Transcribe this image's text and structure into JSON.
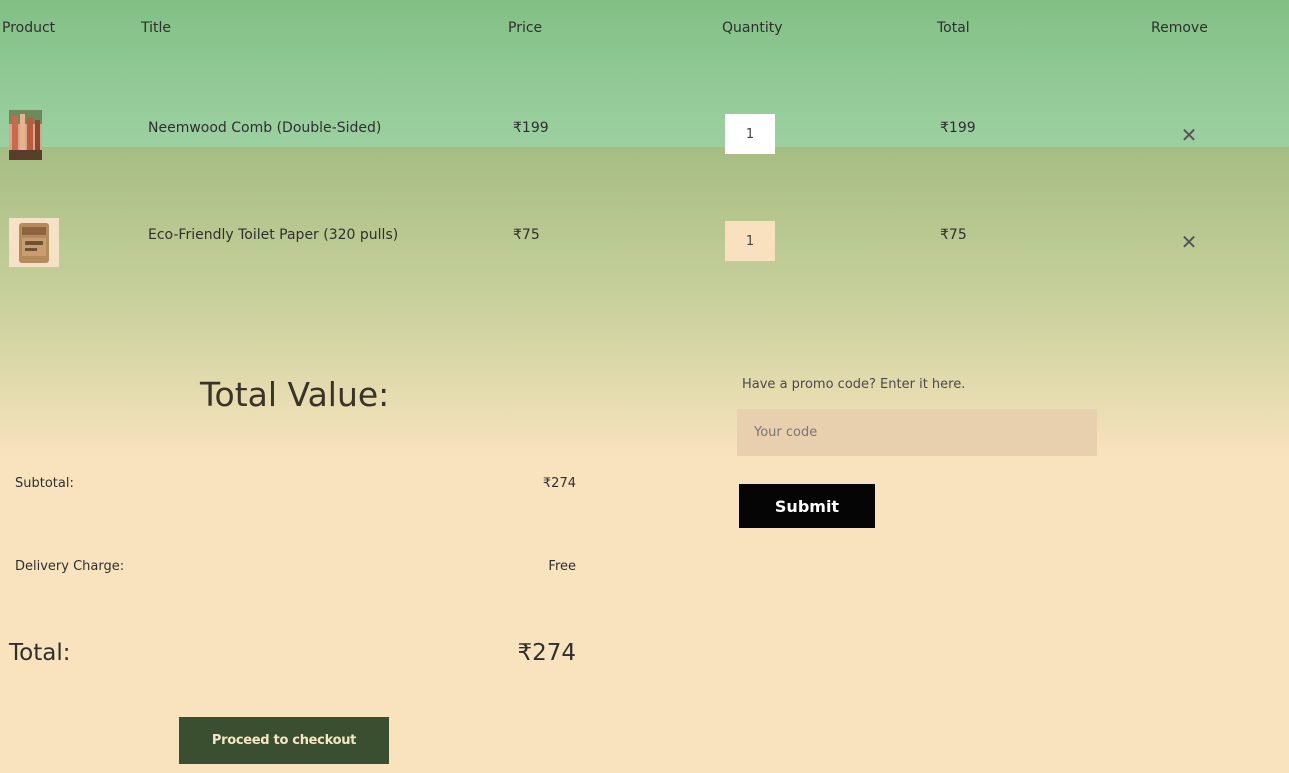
{
  "table": {
    "headers": {
      "product": "Product",
      "title": "Title",
      "price": "Price",
      "quantity": "Quantity",
      "total": "Total",
      "remove": "Remove"
    },
    "rows": [
      {
        "title": "Neemwood Comb (Double-Sided)",
        "price": "₹199",
        "quantity": "1",
        "total": "₹199",
        "remove_icon": "close-icon",
        "remove_glyph": "✕"
      },
      {
        "title": "Eco-Friendly Toilet Paper (320 pulls)",
        "price": "₹75",
        "quantity": "1",
        "total": "₹75",
        "remove_icon": "close-icon",
        "remove_glyph": "✕"
      }
    ]
  },
  "summary": {
    "heading": "Total Value:",
    "subtotal_label": "Subtotal:",
    "subtotal_value": "₹274",
    "delivery_label": "Delivery Charge:",
    "delivery_value": "Free",
    "total_label": "Total:",
    "total_value": "₹274",
    "checkout_label": "Proceed to checkout"
  },
  "promo": {
    "label": "Have a promo code? Enter it here.",
    "placeholder": "Your code",
    "value": "",
    "submit_label": "Submit"
  },
  "colors": {
    "header_green": "#82c086",
    "page_cream": "#f9e3bf",
    "checkout_button": "#3a4f2f",
    "submit_button": "#050505",
    "promo_input": "#e8d0af"
  }
}
